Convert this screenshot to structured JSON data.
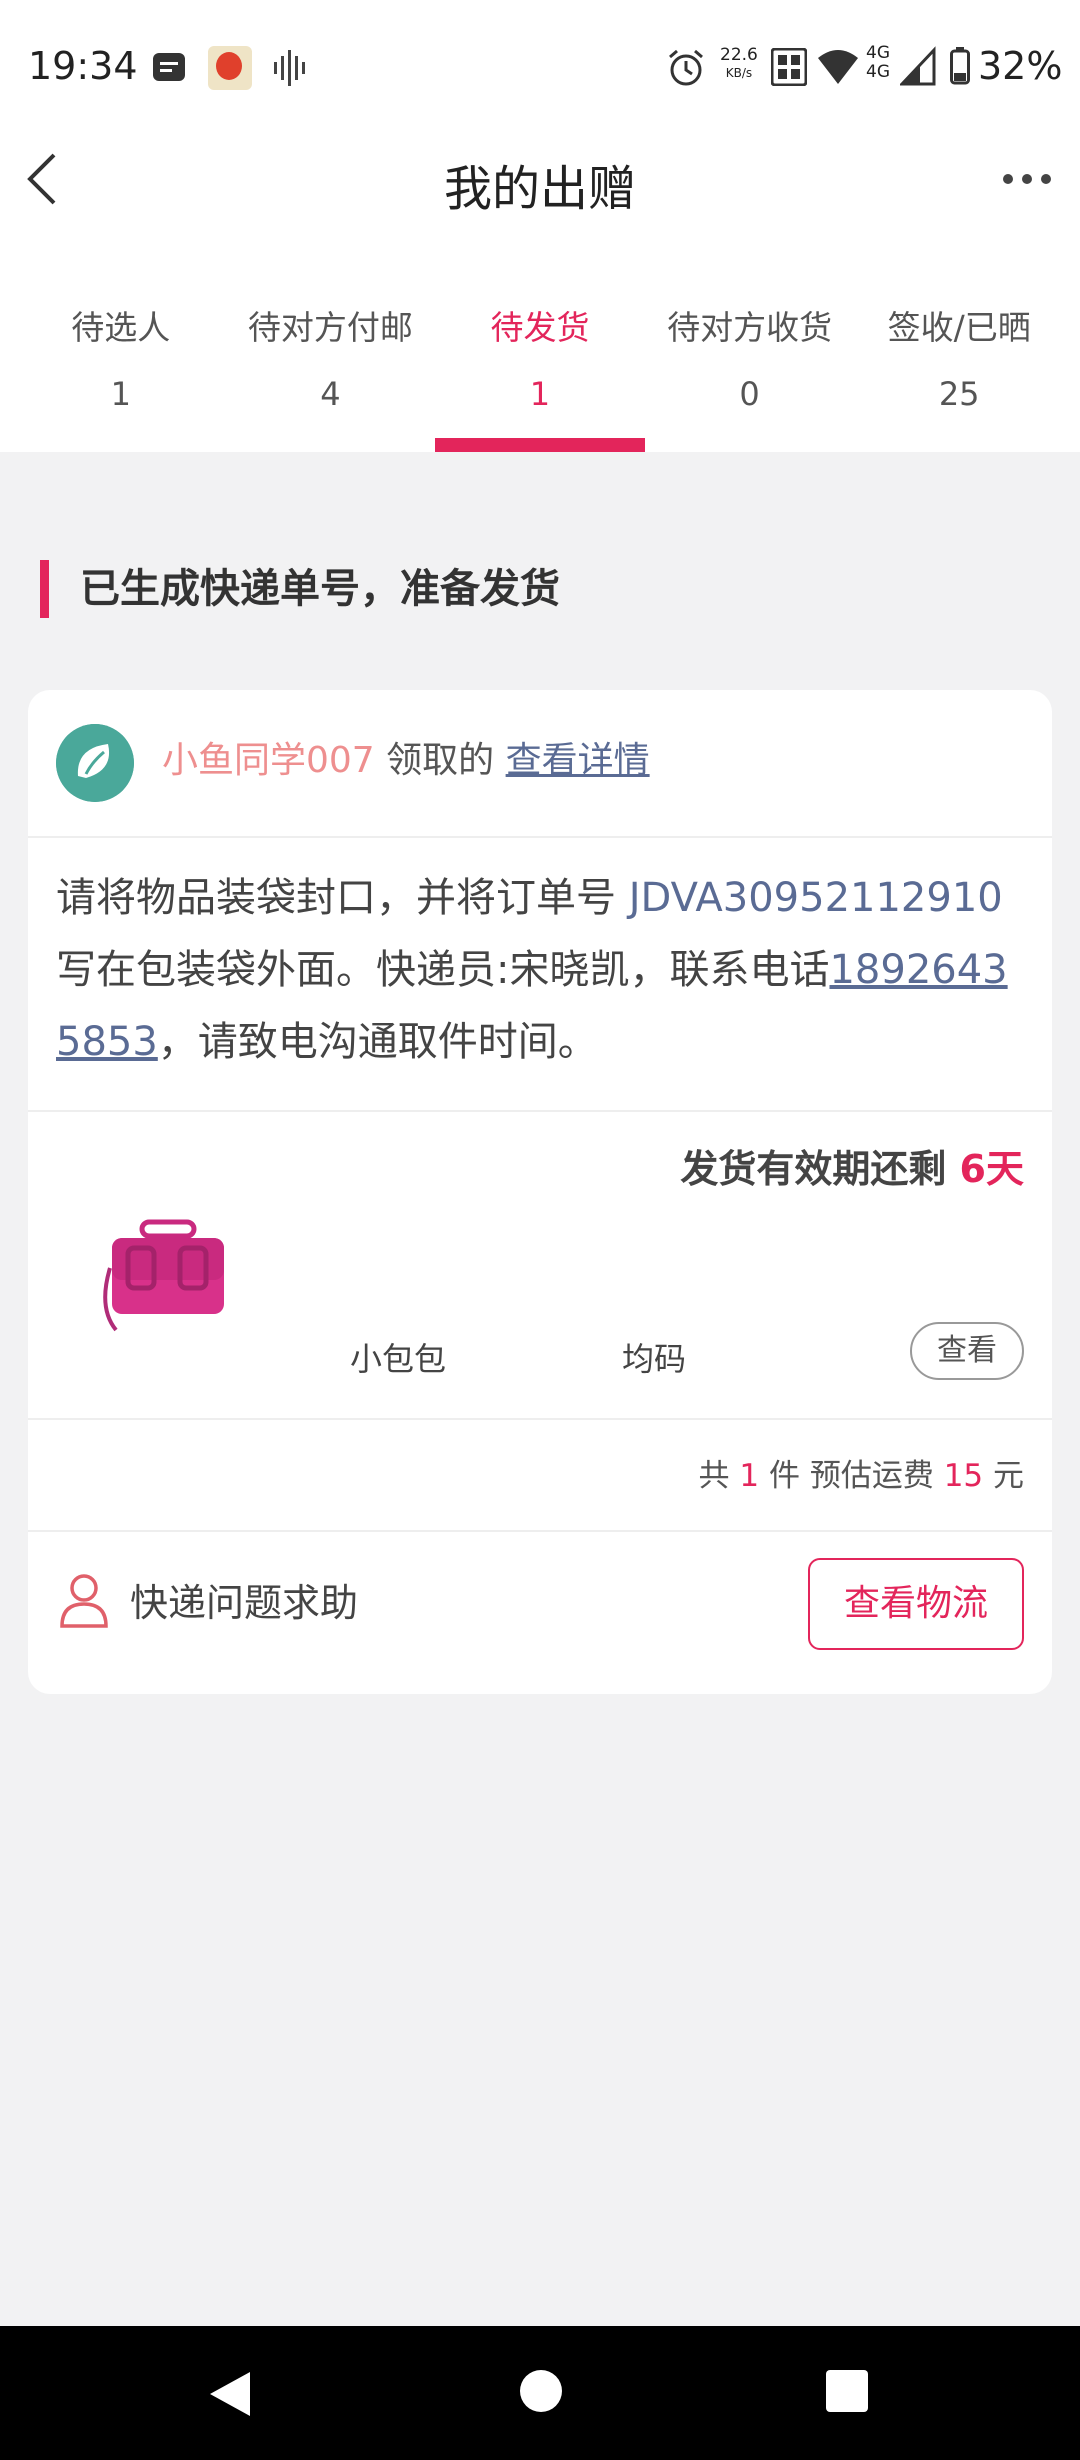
{
  "status_bar": {
    "time": "19:34",
    "net_speed": "22.6",
    "net_speed_unit": "KB/s",
    "network": "4G",
    "network2": "4G",
    "battery": "32%"
  },
  "header": {
    "title": "我的出赠"
  },
  "tabs": [
    {
      "label": "待选人",
      "count": "1"
    },
    {
      "label": "待对方付邮",
      "count": "4"
    },
    {
      "label": "待发货",
      "count": "1",
      "active": true
    },
    {
      "label": "待对方收货",
      "count": "0"
    },
    {
      "label": "签收/已晒",
      "count": "25"
    }
  ],
  "section": {
    "heading": "已生成快递单号，准备发货"
  },
  "card": {
    "user": {
      "name": "小鱼同学007",
      "verb": " 领取的 ",
      "detail_link": "查看详情"
    },
    "instruction": {
      "part1": "请将物品装袋封口，并将订单号 ",
      "order_no": "JDVA30952112910",
      "part2": " 写在包装袋外面。快递员:宋晓凯，联系电话",
      "phone": "18926435853",
      "part3": "，请致电沟通取件时间。"
    },
    "deadline": {
      "label": "发货有效期还剩 ",
      "days": "6天"
    },
    "product": {
      "name": "小包包",
      "size": "均码",
      "view_button": "查看"
    },
    "summary": {
      "prefix": "共 ",
      "count": "1",
      "middle": " 件 预估运费 ",
      "fee": "15",
      "suffix": " 元"
    },
    "help": {
      "label": "快递问题求助",
      "logistics_button": "查看物流"
    }
  },
  "colors": {
    "accent": "#e3255b",
    "link": "#5a6b94",
    "name": "#ee8f8f"
  }
}
